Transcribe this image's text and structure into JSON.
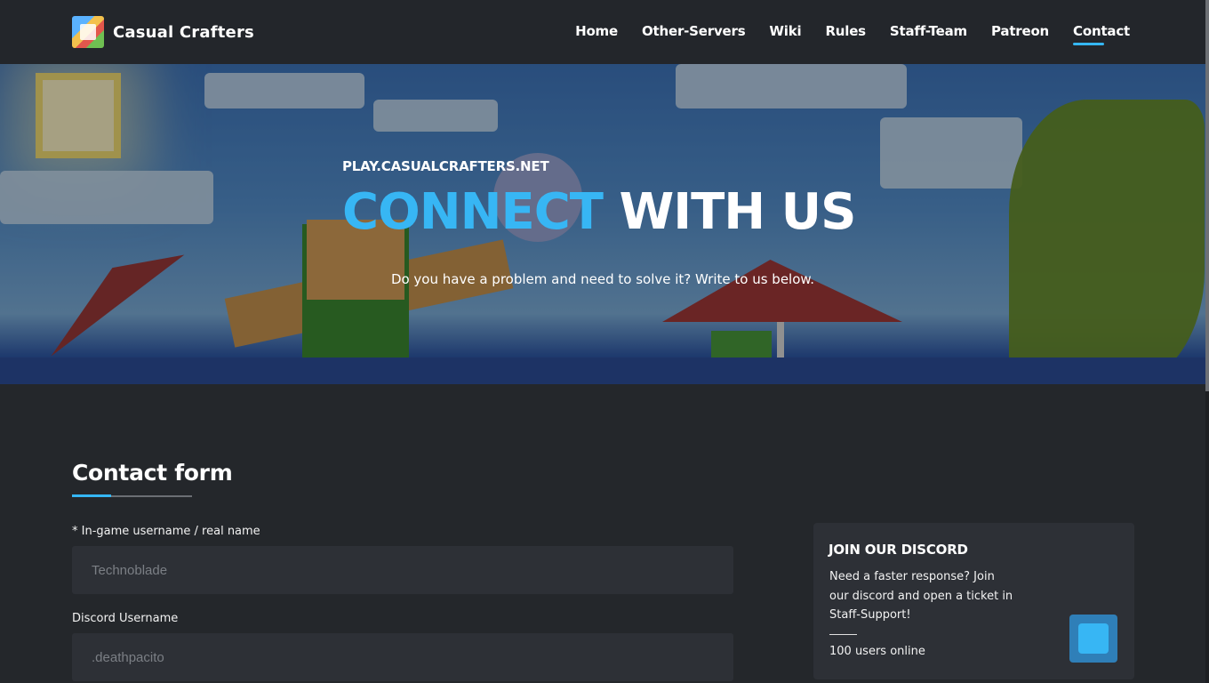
{
  "header": {
    "brand": "Casual Crafters",
    "nav": [
      {
        "label": "Home"
      },
      {
        "label": "Other-Servers"
      },
      {
        "label": "Wiki"
      },
      {
        "label": "Rules"
      },
      {
        "label": "Staff-Team"
      },
      {
        "label": "Patreon"
      },
      {
        "label": "Contact",
        "active": true
      }
    ]
  },
  "hero": {
    "kicker": "PLAY.CASUALCRAFTERS.NET",
    "title_accent": "CONNECT",
    "title_rest": "WITH US",
    "subtitle": "Do you have a problem and need to solve it? Write to us below."
  },
  "contact": {
    "title": "Contact form",
    "fields": [
      {
        "label": "* In-game username / real name",
        "placeholder": "Technoblade"
      },
      {
        "label": "Discord Username",
        "placeholder": ".deathpacito"
      }
    ]
  },
  "discord": {
    "title": "JOIN OUR DISCORD",
    "text": "Need a faster response? Join our discord and open a ticket in Staff-Support!",
    "online": "100 users online"
  },
  "colors": {
    "accent": "#35b7f5",
    "background": "#24272b",
    "panel": "#2d3036"
  },
  "icons": {
    "logo": "casual-crafters-logo",
    "chat": "chat-widget-icon"
  }
}
